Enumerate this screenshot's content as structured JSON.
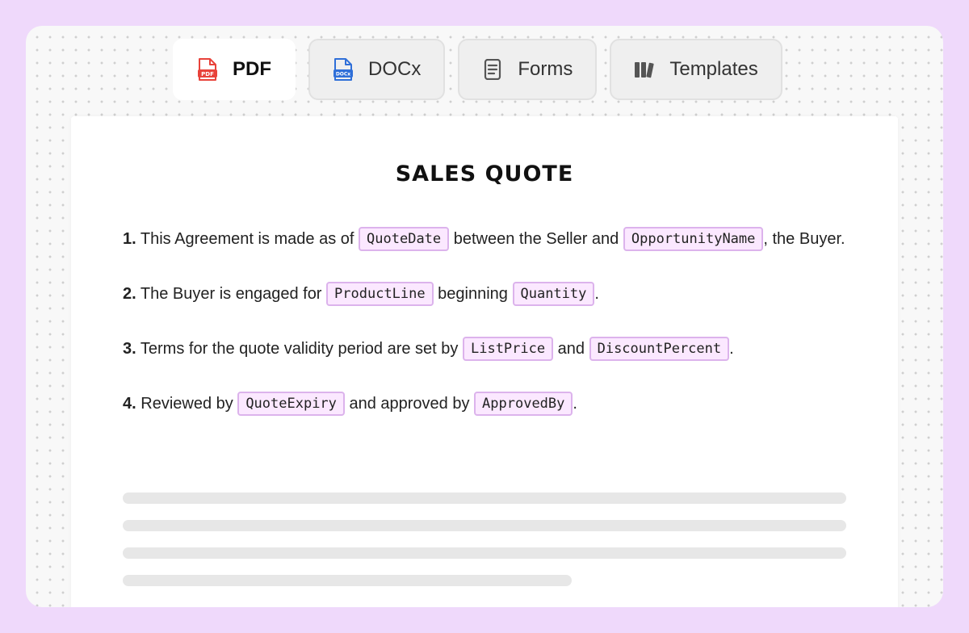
{
  "tabs": [
    {
      "label": "PDF",
      "icon": "pdf-file-icon",
      "active": true
    },
    {
      "label": "DOCx",
      "icon": "docx-file-icon",
      "active": false
    },
    {
      "label": "Forms",
      "icon": "form-document-icon",
      "active": false
    },
    {
      "label": "Templates",
      "icon": "templates-library-icon",
      "active": false
    }
  ],
  "icon_text": {
    "pdf": "PDF",
    "docx": "DOCx"
  },
  "colors": {
    "pdf_icon": "#e8423a",
    "docx_icon": "#2f6fd8",
    "field_bg": "#fbe8ff",
    "field_border": "#dcb3ec",
    "frame": "#efd9fb"
  },
  "document": {
    "title": "SALES QUOTE",
    "clauses": [
      {
        "num": "1.",
        "parts": [
          "This Agreement is made as of ",
          " between the Seller and ",
          ", the Buyer."
        ],
        "fields": [
          "QuoteDate",
          "OpportunityName"
        ]
      },
      {
        "num": "2.",
        "parts": [
          "The Buyer is engaged for ",
          " beginning ",
          "."
        ],
        "fields": [
          "ProductLine",
          "Quantity"
        ]
      },
      {
        "num": "3.",
        "parts": [
          "Terms for the quote validity period are set by ",
          " and ",
          "."
        ],
        "fields": [
          "ListPrice",
          "DiscountPercent"
        ]
      },
      {
        "num": "4.",
        "parts": [
          "Reviewed by ",
          " and approved by ",
          "."
        ],
        "fields": [
          "QuoteExpiry",
          "ApprovedBy"
        ]
      }
    ]
  }
}
